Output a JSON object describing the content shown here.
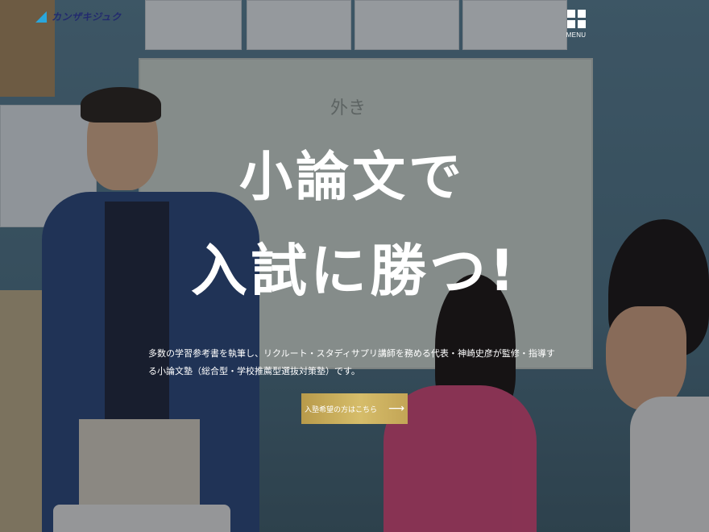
{
  "header": {
    "logo_text": "カンザキジュク",
    "menu_label": "MENU"
  },
  "hero": {
    "title_line1": "小論文で",
    "title_line2": "入試に勝つ!",
    "description_line1": "多数の学習参考書を執筆し、リクルート・スタディサプリ講師を務める代表・神崎史彦が監修・指導す",
    "description_line2": "る小論文塾（総合型・学校推薦型選抜対策塾）です。",
    "cta_label": "入塾希望の方はこちら",
    "cta_icon": "arrow-right-icon"
  },
  "background": {
    "whiteboard_text": "外き"
  },
  "colors": {
    "cta_gold": "#c6a955",
    "logo_blue": "#2aa6dc",
    "logo_navy": "#222a6e",
    "text_white": "#ffffff"
  }
}
